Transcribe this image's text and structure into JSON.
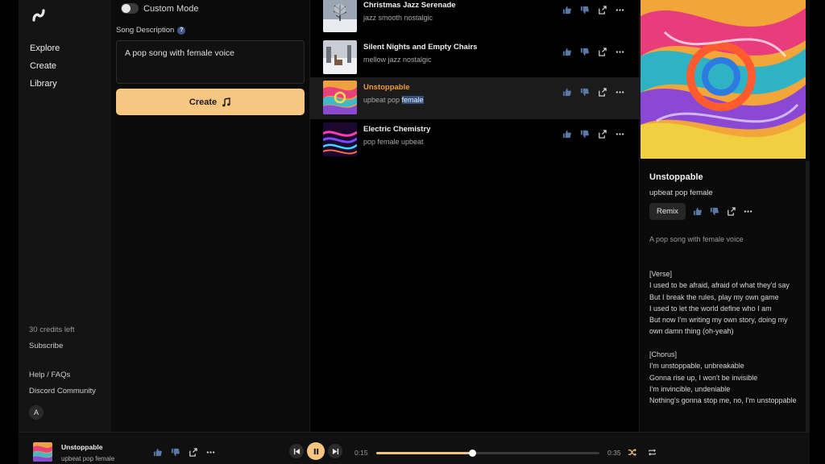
{
  "nav": {
    "items": [
      "Explore",
      "Create",
      "Library"
    ]
  },
  "sidebar_bottom": {
    "credits": "30 credits left",
    "subscribe": "Subscribe",
    "help": "Help / FAQs",
    "discord": "Discord Community",
    "avatar_initial": "A"
  },
  "create_panel": {
    "custom_mode_label": "Custom Mode",
    "custom_mode_on": false,
    "description_label": "Song Description",
    "description_value": "A pop song with female voice",
    "create_button_label": "Create"
  },
  "songs": [
    {
      "title": "Christmas Jazz Serenade",
      "tags": "jazz smooth nostalgic",
      "thumb": "snow-tree"
    },
    {
      "title": "Silent Nights and Empty Chairs",
      "tags": "mellow jazz nostalgic",
      "thumb": "snow-scene"
    },
    {
      "title": "Unstoppable",
      "tags_prefix": "upbeat pop ",
      "tags_highlight": "female",
      "thumb": "swirl",
      "playing": true
    },
    {
      "title": "Electric Chemistry",
      "tags": "pop female upbeat",
      "thumb": "neon"
    }
  ],
  "detail": {
    "title": "Unstoppable",
    "tags": "upbeat pop female",
    "remix_label": "Remix",
    "prompt": "A pop song with female voice",
    "lyrics": [
      "[Verse]",
      "I used to be afraid, afraid of what they'd say",
      "But I break the rules, play my own game",
      "I used to let the world define who I am",
      "But now I'm writing my own story, doing my own damn thing (oh-yeah)",
      "",
      "[Chorus]",
      "I'm unstoppable, unbreakable",
      "Gonna rise up, I won't be invisible",
      "I'm invincible, undeniable",
      "Nothing's gonna stop me, no, I'm unstoppable"
    ]
  },
  "player": {
    "title": "Unstoppable",
    "tags": "upbeat pop female",
    "elapsed": "0:15",
    "duration": "0:35",
    "progress": 0.4286,
    "state": "playing"
  },
  "colors": {
    "accent": "#f7c781",
    "playing_title": "#f39a3b",
    "highlight": "#34507a"
  }
}
